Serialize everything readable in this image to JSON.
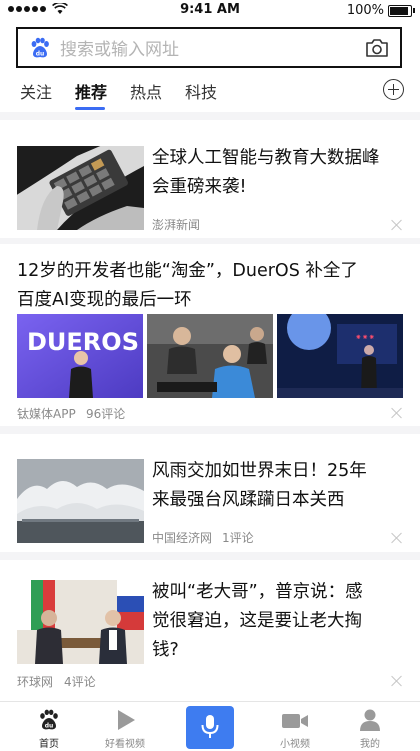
{
  "status_bar": {
    "time": "9:41 AM",
    "battery": "100%",
    "battery_level": 1.0
  },
  "search": {
    "placeholder": "搜索或输入网址"
  },
  "tabs": [
    {
      "label": "关注",
      "active": false
    },
    {
      "label": "推荐",
      "active": true
    },
    {
      "label": "热点",
      "active": false
    },
    {
      "label": "科技",
      "active": false
    }
  ],
  "colors": {
    "accent": "#3b6cf3",
    "mic_button": "#3e7cf0",
    "meta_text": "#8a8a8a"
  },
  "articles": [
    {
      "title_lines": [
        "全球人工智能与教育大数据峰",
        "会重磅来袭!"
      ],
      "source": "澎湃新闻",
      "comments": ""
    },
    {
      "title_lines": [
        "12岁的开发者也能“淘金”，DuerOS 补全了",
        "百度AI变现的最后一环"
      ],
      "source": "钛媒体APP",
      "comments": "96评论",
      "image_text": "DUEROS"
    },
    {
      "title_lines": [
        "风雨交加如世界末日！25年",
        "来最强台风蹂躏日本关西"
      ],
      "source": "中国经济网",
      "comments": "1评论"
    },
    {
      "title_lines": [
        "被叫“老大哥”，普京说：感",
        "觉很窘迫，这是要让老大掏",
        "钱?"
      ],
      "source": "环球网",
      "comments": "4评论"
    }
  ],
  "bottom_nav": [
    {
      "label": "首页",
      "icon": "baidu-paw-icon",
      "active": true
    },
    {
      "label": "好看视频",
      "icon": "play-icon",
      "active": false
    },
    {
      "label": "",
      "icon": "microphone-icon",
      "active": false
    },
    {
      "label": "小视频",
      "icon": "video-camera-icon",
      "active": false
    },
    {
      "label": "我的",
      "icon": "person-icon",
      "active": false
    }
  ]
}
